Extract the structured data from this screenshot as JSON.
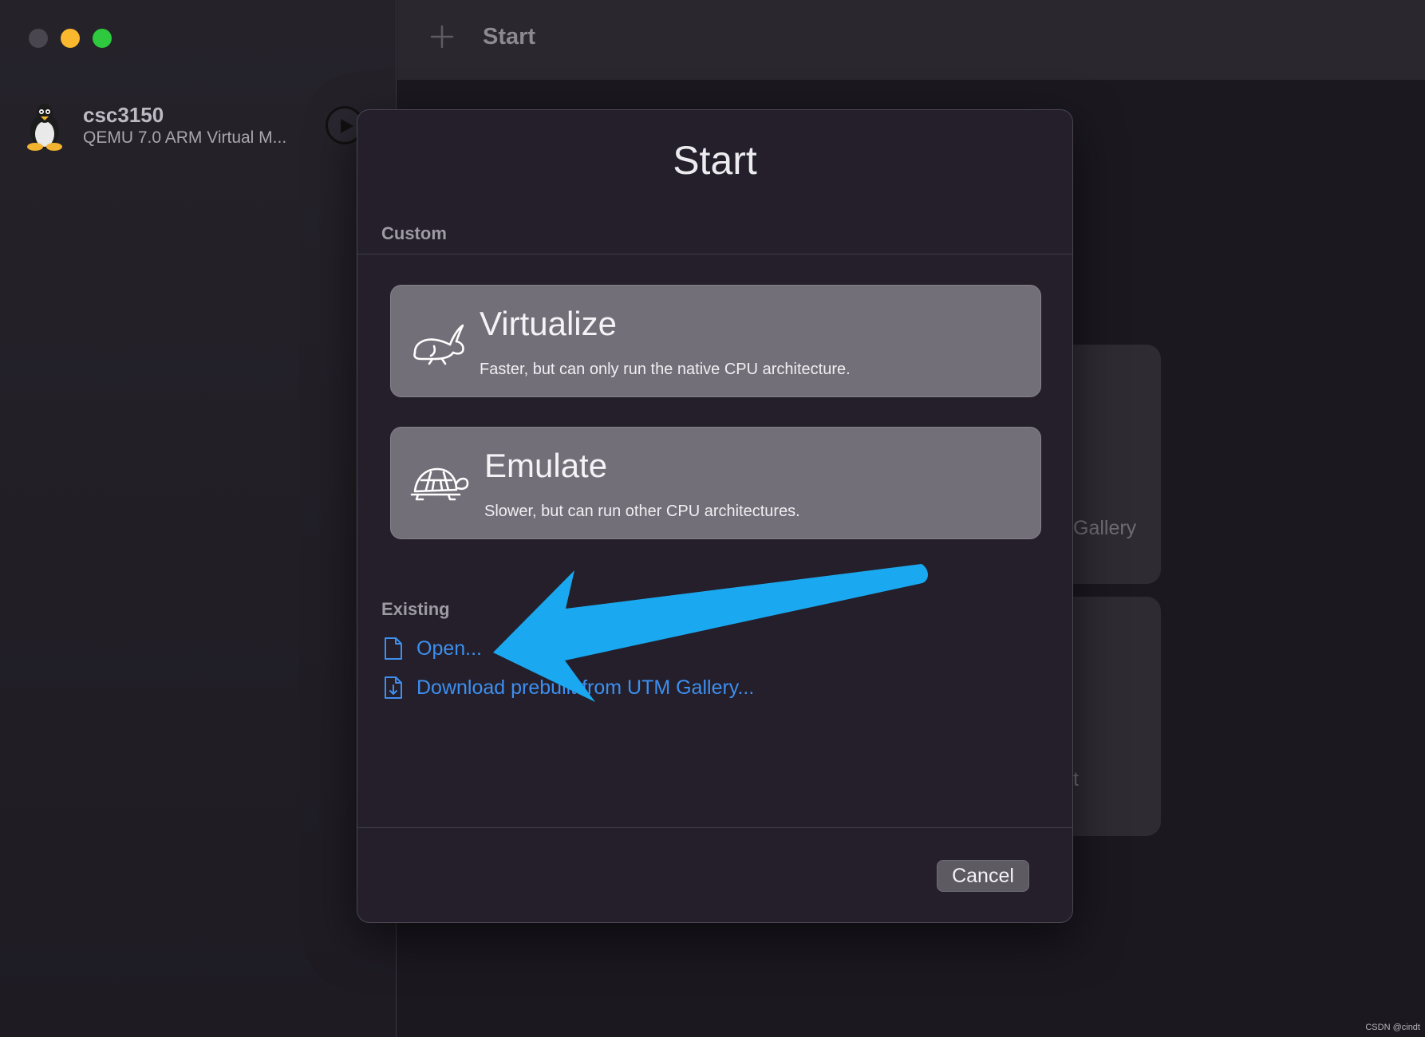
{
  "sidebar": {
    "vm": {
      "name": "csc3150",
      "description": "QEMU 7.0 ARM Virtual M..."
    }
  },
  "header": {
    "title": "Start"
  },
  "background_cards": [
    {
      "label": "Gallery"
    },
    {
      "label": "t"
    }
  ],
  "dialog": {
    "title": "Start",
    "custom_label": "Custom",
    "options": [
      {
        "title": "Virtualize",
        "description": "Faster, but can only run the native CPU architecture.",
        "icon": "rabbit-icon"
      },
      {
        "title": "Emulate",
        "description": "Slower, but can run other CPU architectures.",
        "icon": "turtle-icon"
      }
    ],
    "existing_label": "Existing",
    "links": [
      {
        "label": "Open...",
        "icon": "document-icon"
      },
      {
        "label": "Download prebuilt from UTM Gallery...",
        "icon": "document-download-icon"
      }
    ],
    "cancel_label": "Cancel"
  },
  "annotation": {
    "arrow_color": "#1aa9f0"
  },
  "watermark": "CSDN @cindt",
  "colors": {
    "link": "#3d8ff0",
    "traffic_min": "#f9b82e",
    "traffic_max": "#2ec93f"
  }
}
